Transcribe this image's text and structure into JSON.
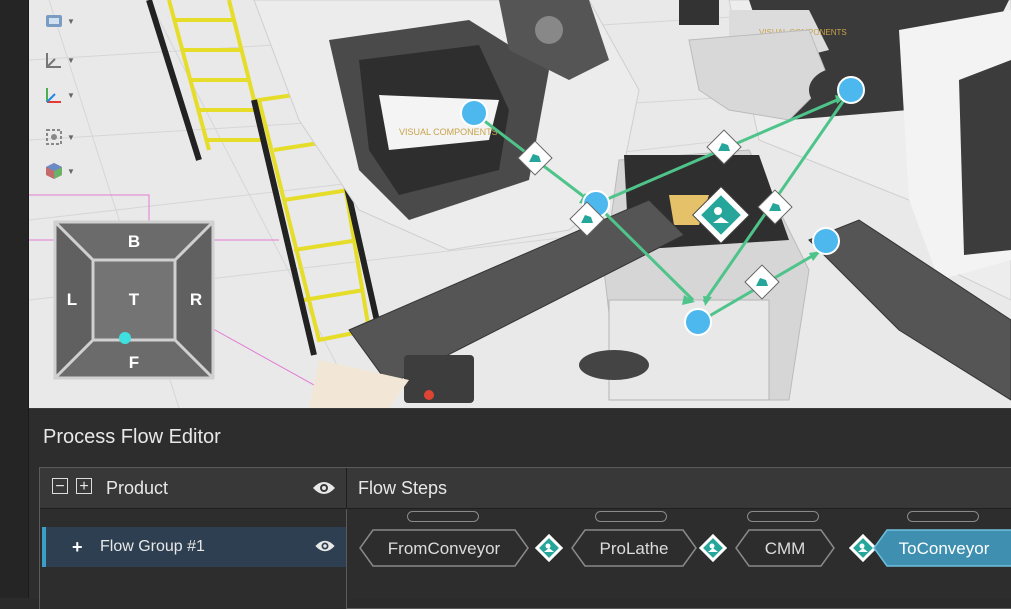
{
  "viewport": {
    "nav_cube": {
      "top": "B",
      "left": "L",
      "center": "T",
      "right": "R",
      "bottom": "F"
    },
    "tools": [
      "display-icon",
      "axis-icon",
      "local-axis-icon",
      "snap-icon",
      "view-cube-icon"
    ],
    "colors": {
      "flow_arrow": "#4fc48a",
      "node": "#4cb8ee",
      "badge": "#26a69a"
    }
  },
  "editor": {
    "title": "Process Flow Editor",
    "product_header": "Product",
    "steps_header": "Flow Steps",
    "collapse_symbol": "−",
    "expand_symbol": "+",
    "flow_group": {
      "expand_symbol": "+",
      "label": "Flow Group #1"
    },
    "steps": [
      {
        "label": "FromConveyor",
        "active": false
      },
      {
        "label": "ProLathe",
        "active": false
      },
      {
        "label": "CMM",
        "active": false
      },
      {
        "label": "ToConveyor",
        "active": true
      }
    ],
    "colors": {
      "accent": "#3b9ec4",
      "active_step": "#3f8fb0",
      "row_selected": "#2d3f50"
    }
  }
}
